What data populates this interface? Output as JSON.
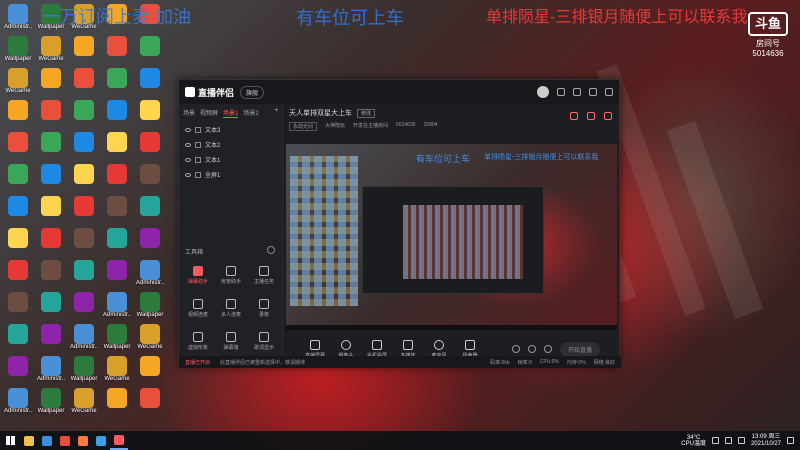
{
  "overlay": {
    "left_text": "一万订阅上麦 加油",
    "center_text": "有车位可上车",
    "right_text": "单排陨星-三排银月随便上可以联系我"
  },
  "badge": {
    "logo_text": "斗鱼",
    "room_label": "房间号",
    "room_number": "5014636"
  },
  "desktop_icons": [
    {
      "label": "Administr..",
      "color": "#4a90d9"
    },
    {
      "label": "Wallpaper",
      "color": "#2c7a3c"
    },
    {
      "label": "WeGame",
      "color": "#d8a02a"
    },
    {
      "label": "",
      "color": "#f5a623"
    },
    {
      "label": "",
      "color": "#e94f3a"
    },
    {
      "label": "",
      "color": "#3aa757"
    },
    {
      "label": "",
      "color": "#1e88e5"
    },
    {
      "label": "",
      "color": "#ffd54f"
    },
    {
      "label": "",
      "color": "#e53935"
    },
    {
      "label": "",
      "color": "#6d4c41"
    },
    {
      "label": "",
      "color": "#26a69a"
    },
    {
      "label": "",
      "color": "#8e24aa"
    }
  ],
  "app": {
    "name": "直播伴侣",
    "mode": "旗舰",
    "scene_tabs": [
      "场景",
      "视频屏",
      "场景1",
      "场景2"
    ],
    "sources": [
      "文本3",
      "文本2",
      "文本1",
      "全屏1"
    ],
    "toolbox_title": "工具箱",
    "tools": [
      {
        "label": "弹幕助手",
        "highlight": true
      },
      {
        "label": "房管助手",
        "highlight": false
      },
      {
        "label": "主播任务",
        "highlight": false
      },
      {
        "label": "视频连麦",
        "highlight": false
      },
      {
        "label": "多人连麦",
        "highlight": false
      },
      {
        "label": "录像",
        "highlight": false
      },
      {
        "label": "虚拟形象",
        "highlight": false
      },
      {
        "label": "弹幕墙",
        "highlight": false
      },
      {
        "label": "歌词显示",
        "highlight": false
      }
    ],
    "room_title": "天人单排双星大上车",
    "edit_label": "修改",
    "room_category": "永劫无间",
    "room_type": "大神陪玩",
    "room_label": "开发在主播房间",
    "room_number": "5014636",
    "fans": "15804",
    "preview_texts": {
      "center": "有车位可上车",
      "right": "单排陨星-三排银月随便上可以联系我"
    },
    "controls": [
      "直播屏幕",
      "摄像头",
      "手机投屏",
      "多媒体",
      "麦克风",
      "扬声器"
    ],
    "go_live": "开始直播",
    "status_warning": "直播已开启",
    "status_message": "此直播伴侣已被重新选择中，敬请期待",
    "stats": [
      "码率:0kb",
      "帧率:0",
      "CPU:0%",
      "内存:0%",
      "网络:良好"
    ]
  },
  "taskbar": {
    "apps": [
      {
        "name": "explorer",
        "color": "#f3c14b"
      },
      {
        "name": "edge",
        "color": "#3b8fe0"
      },
      {
        "name": "chrome",
        "color": "#e94f3a"
      },
      {
        "name": "media",
        "color": "#ff7b3a"
      },
      {
        "name": "qq",
        "color": "#3aa0e8"
      },
      {
        "name": "obs",
        "color": "#ff5a5f"
      }
    ],
    "temp": "34°C",
    "cpu": "CPU温度",
    "time": "13:09 周三",
    "date": "2021/10/27"
  }
}
